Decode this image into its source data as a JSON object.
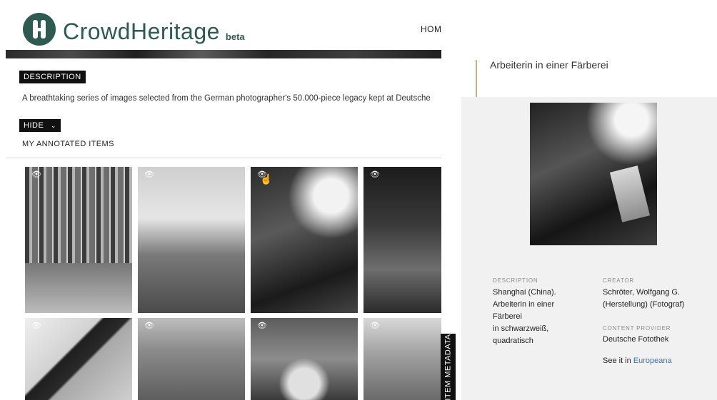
{
  "header": {
    "logo_name": "CrowdHeritage",
    "logo_badge": "beta",
    "nav_home": "HOME"
  },
  "collection": {
    "description_label": "DESCRIPTION",
    "description_text": "A breathtaking series of images selected from the German photographer's 50.000-piece legacy kept at Deutsche",
    "hide_label": "HIDE",
    "my_annotated_items": "MY ANNOTATED ITEMS"
  },
  "thumbnails": [
    {
      "icon": "eye-icon"
    },
    {
      "icon": "eye-icon"
    },
    {
      "icon": "eye-icon"
    },
    {
      "icon": "eye-icon"
    },
    {
      "icon": "eye-icon"
    },
    {
      "icon": "eye-icon"
    },
    {
      "icon": "eye-icon"
    },
    {
      "icon": "eye-icon"
    }
  ],
  "item_metadata_tab": "ITEM METADATA",
  "item": {
    "title": "Arbeiterin in einer Färberei",
    "description_label": "DESCRIPTION",
    "description_lines": [
      "Shanghai (China).",
      "Arbeiterin in einer",
      "Färberei",
      "in schwarzweiß,",
      "quadratisch"
    ],
    "creator_label": "CREATOR",
    "creator_lines": [
      "Schröter, Wolfgang G.",
      "(Herstellung) (Fotograf)"
    ],
    "provider_label": "CONTENT PROVIDER",
    "provider_value": "Deutsche Fotothek",
    "see_it_prefix": "See it in",
    "see_it_link": "Europeana"
  },
  "colors": {
    "brand": "#2f5a52",
    "accent": "#c9b27b",
    "link": "#3a74b8"
  }
}
